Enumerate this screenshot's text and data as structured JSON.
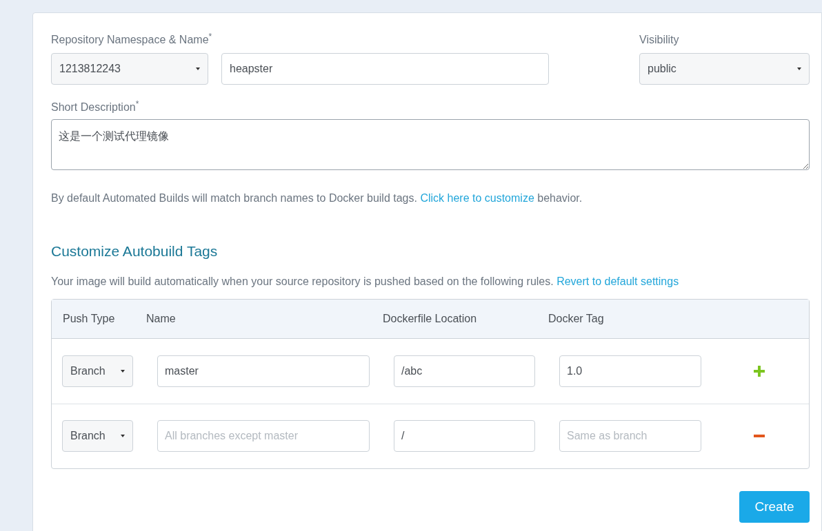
{
  "repository": {
    "label": "Repository Namespace & Name",
    "required_mark": "*",
    "namespace": "1213812243",
    "name": "heapster"
  },
  "visibility": {
    "label": "Visibility",
    "value": "public"
  },
  "description": {
    "label": "Short Description",
    "required_mark": "*",
    "value": "这是一个测试代理镜像"
  },
  "info": {
    "text": "By default Automated Builds will match branch names to Docker build tags.",
    "link": "Click here to customize",
    "after": "behavior."
  },
  "section": {
    "title": "Customize Autobuild Tags",
    "text": "Your image will build automatically when your source repository is pushed based on the following rules.",
    "link": "Revert to default settings"
  },
  "table": {
    "columns": [
      "Push Type",
      "Name",
      "Dockerfile Location",
      "Docker Tag"
    ],
    "rows": [
      {
        "push_type": "Branch",
        "name": {
          "value": "master"
        },
        "location": {
          "value": "/abc"
        },
        "tag": {
          "value": "1.0"
        },
        "kind": "add"
      },
      {
        "push_type": "Branch",
        "name": {
          "placeholder": "All branches except master"
        },
        "location": {
          "value": "/"
        },
        "tag": {
          "placeholder": "Same as branch"
        },
        "kind": "remove"
      }
    ]
  },
  "create_button": "Create"
}
